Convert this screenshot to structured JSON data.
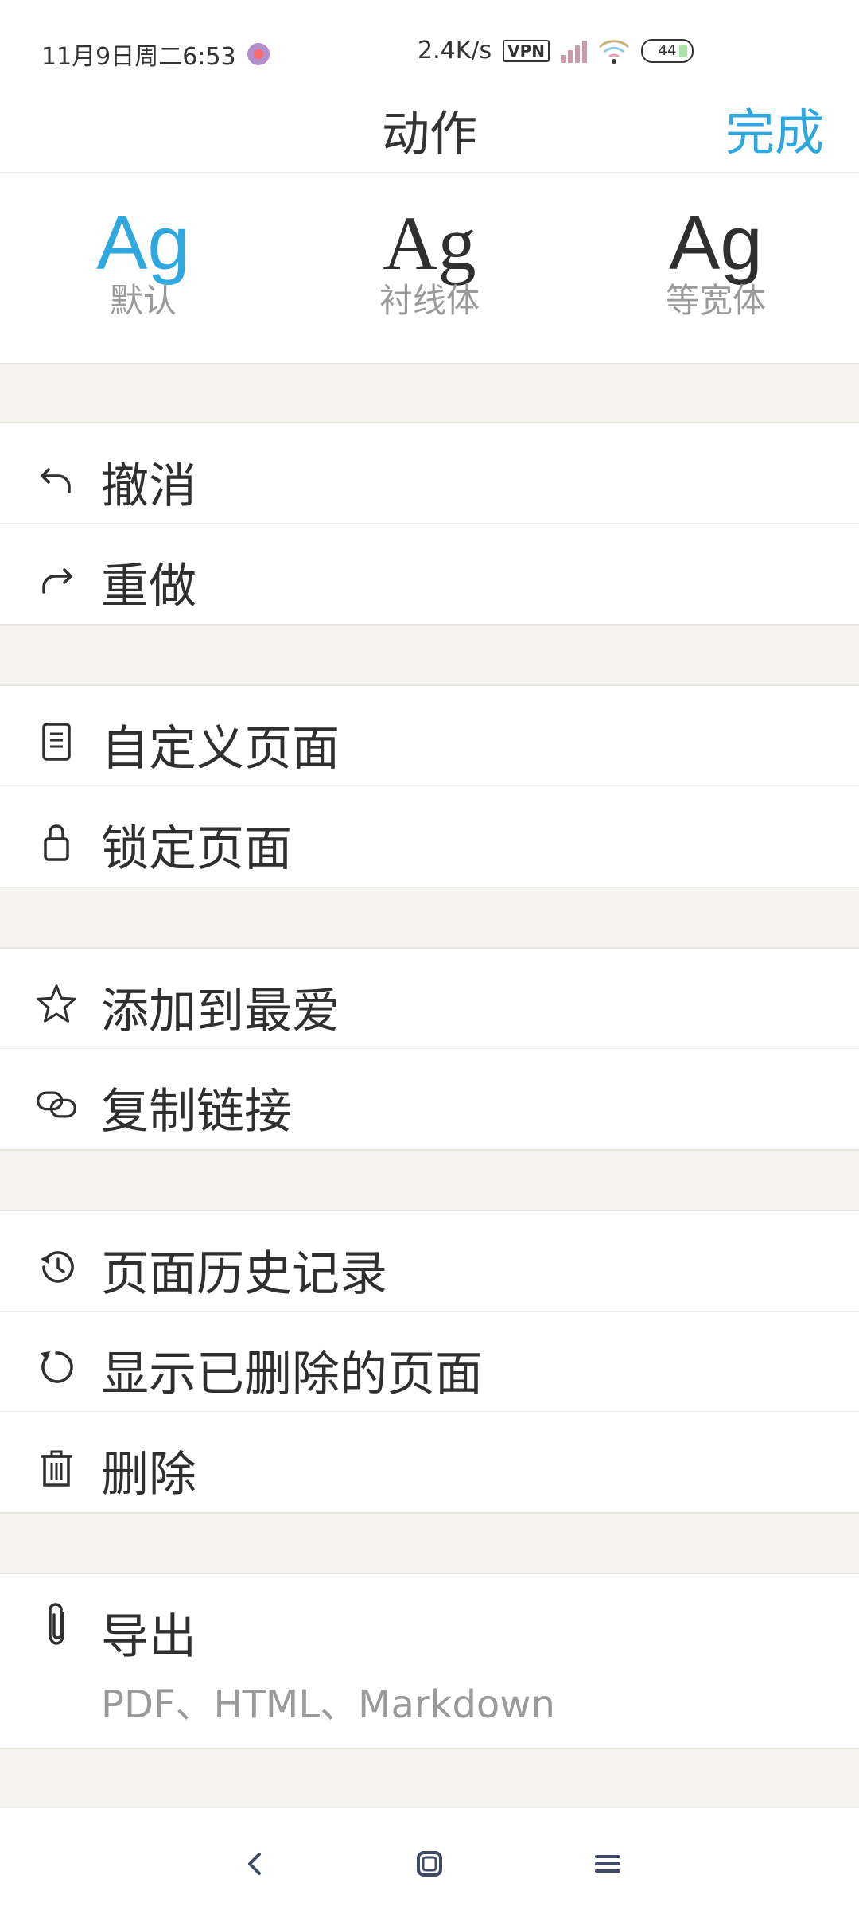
{
  "status_bar": {
    "time": "11月9日周二6:53",
    "speed": "2.4K/s",
    "vpn": "VPN",
    "battery": "44"
  },
  "header": {
    "title": "动作",
    "done_label": "完成"
  },
  "font_options": [
    {
      "sample": "Ag",
      "name": "默认",
      "selected": true
    },
    {
      "sample": "Ag",
      "name": "衬线体",
      "selected": false
    },
    {
      "sample": "Ag",
      "name": "等宽体",
      "selected": false
    }
  ],
  "actions": {
    "undo": {
      "label": "撤消",
      "icon": "undo-icon"
    },
    "redo": {
      "label": "重做",
      "icon": "redo-icon"
    },
    "customize_page": {
      "label": "自定义页面",
      "icon": "page-icon"
    },
    "lock_page": {
      "label": "锁定页面",
      "icon": "lock-icon"
    },
    "add_favorite": {
      "label": "添加到最爱",
      "icon": "star-icon"
    },
    "copy_link": {
      "label": "复制链接",
      "icon": "link-icon"
    },
    "page_history": {
      "label": "页面历史记录",
      "icon": "history-icon"
    },
    "show_deleted": {
      "label": "显示已删除的页面",
      "icon": "restore-icon"
    },
    "delete": {
      "label": "删除",
      "icon": "trash-icon"
    },
    "export": {
      "label": "导出",
      "sub": "PDF、HTML、Markdown",
      "icon": "paperclip-icon"
    }
  },
  "colors": {
    "accent": "#2ea8de",
    "gap_background": "#f5f4f1"
  }
}
